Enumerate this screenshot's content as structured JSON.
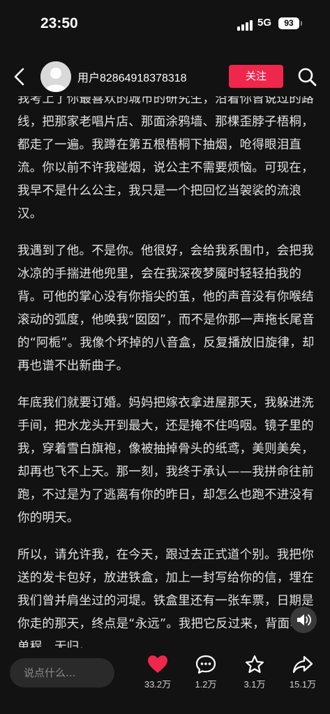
{
  "status_bar": {
    "time": "23:50",
    "network": "5G",
    "battery": "93"
  },
  "header": {
    "username": "用户82864918378318",
    "follow_label": "关注",
    "icons": {
      "back": "back-arrow-icon",
      "search": "search-icon",
      "avatar": "avatar-icon"
    },
    "follow_color": "#f0274d"
  },
  "article": {
    "paragraphs": [
      "我考上了你最喜欢的城市的研究生，沿着你曾说过的路线，把那家老唱片店、那面涂鸦墙、那棵歪脖子梧桐，都走了一遍。我蹲在第五根梧桐下抽烟，呛得眼泪直流。你以前不许我碰烟，说公主不需要烦恼。可现在，我早不是什么公主，我只是一个把回忆当袈裟的流浪汉。",
      "我遇到了他。不是你。他很好，会给我系围巾，会把我冰凉的手揣进他兜里，会在我深夜梦魇时轻轻拍我的背。可他的掌心没有你指尖的茧，他的声音没有你喉结滚动的弧度，他唤我“囡囡”，而不是你那一声拖长尾音的“阿栀”。我像个坏掉的八音盒，反复播放旧旋律，却再也谱不出新曲子。",
      "年底我们就要订婚。妈妈把嫁衣拿进屋那天，我躲进洗手间，把水龙头开到最大，还是掩不住呜咽。镜子里的我，穿着雪白旗袍，像被抽掉骨头的纸鸢，美则美矣，却再也飞不上天。那一刻，我终于承认——我拼命往前跑，不过是为了逃离有你的昨日，却怎么也跑不进没有你的明天。",
      "所以，请允许我，在今天，跟过去正式道个别。我把你送的发卡包好，放进铁盒，加上一封写给你的信，埋在我们曾并肩坐过的河堤。铁盒里还有一张车票，日期是你走的那天，终点是“永远”。我把它反过来，背面写：单程，无归。"
    ]
  },
  "bottom_bar": {
    "comment_placeholder": "说点什么...",
    "like_count": "33.2万",
    "comment_count": "1.2万",
    "favorite_count": "3.1万",
    "share_count": "15.1万",
    "like_color": "#f0274d",
    "icons": {
      "like": "heart-icon",
      "comment": "comment-bubble-icon",
      "favorite": "star-icon",
      "share": "share-arrow-icon",
      "sound": "speaker-icon"
    }
  }
}
